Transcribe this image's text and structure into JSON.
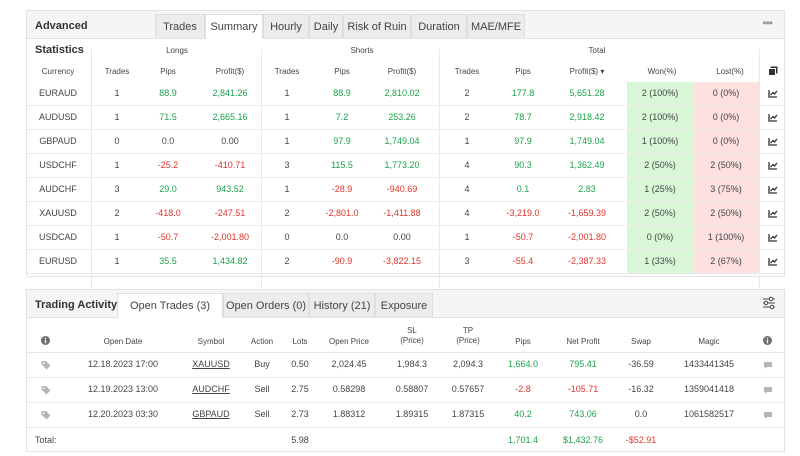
{
  "stats": {
    "title": "Advanced Statistics",
    "tabs": [
      "Trades",
      "Summary",
      "Hourly",
      "Daily",
      "Risk of Ruin",
      "Duration",
      "MAE/MFE"
    ],
    "active_tab": "Summary",
    "group_longs": "Longs",
    "group_shorts": "Shorts",
    "group_total": "Total",
    "columns": [
      "Currency",
      "Trades",
      "Pips",
      "Profit($)",
      "Trades",
      "Pips",
      "Profit($)",
      "Trades",
      "Pips",
      "Profit($)",
      "Won(%)",
      "Lost(%)"
    ],
    "rows": [
      {
        "currency": "EURAUD",
        "lt": "1",
        "lp": "88.9",
        "lpr": "2,841.26",
        "st": "1",
        "sp": "88.9",
        "spr": "2,810.02",
        "tt": "2",
        "tp": "177.8",
        "tpr": "5,651.28",
        "won": "2 (100%)",
        "lost": "0 (0%)"
      },
      {
        "currency": "AUDUSD",
        "lt": "1",
        "lp": "71.5",
        "lpr": "2,665.16",
        "st": "1",
        "sp": "7.2",
        "spr": "253.26",
        "tt": "2",
        "tp": "78.7",
        "tpr": "2,918.42",
        "won": "2 (100%)",
        "lost": "0 (0%)"
      },
      {
        "currency": "GBPAUD",
        "lt": "0",
        "lp": "0.0",
        "lpr": "0.00",
        "st": "1",
        "sp": "97.9",
        "spr": "1,749.04",
        "tt": "1",
        "tp": "97.9",
        "tpr": "1,749.04",
        "won": "1 (100%)",
        "lost": "0 (0%)"
      },
      {
        "currency": "USDCHF",
        "lt": "1",
        "lp": "-25.2",
        "lpr": "-410.71",
        "st": "3",
        "sp": "115.5",
        "spr": "1,773.20",
        "tt": "4",
        "tp": "90.3",
        "tpr": "1,362.49",
        "won": "2 (50%)",
        "lost": "2 (50%)"
      },
      {
        "currency": "AUDCHF",
        "lt": "3",
        "lp": "29.0",
        "lpr": "943.52",
        "st": "1",
        "sp": "-28.9",
        "spr": "-940.69",
        "tt": "4",
        "tp": "0.1",
        "tpr": "2.83",
        "won": "1 (25%)",
        "lost": "3 (75%)"
      },
      {
        "currency": "XAUUSD",
        "lt": "2",
        "lp": "-418.0",
        "lpr": "-247.51",
        "st": "2",
        "sp": "-2,801.0",
        "spr": "-1,411.88",
        "tt": "4",
        "tp": "-3,219.0",
        "tpr": "-1,659.39",
        "won": "2 (50%)",
        "lost": "2 (50%)"
      },
      {
        "currency": "USDCAD",
        "lt": "1",
        "lp": "-50.7",
        "lpr": "-2,001.80",
        "st": "0",
        "sp": "0.0",
        "spr": "0.00",
        "tt": "1",
        "tp": "-50.7",
        "tpr": "-2,001.80",
        "won": "0 (0%)",
        "lost": "1 (100%)"
      },
      {
        "currency": "EURUSD",
        "lt": "1",
        "lp": "35.5",
        "lpr": "1,434.82",
        "st": "2",
        "sp": "-90.9",
        "spr": "-3,822.15",
        "tt": "3",
        "tp": "-55.4",
        "tpr": "-2,387.33",
        "won": "1 (33%)",
        "lost": "2 (67%)"
      }
    ]
  },
  "activity": {
    "title": "Trading Activity",
    "tabs": [
      "Open Trades (3)",
      "Open Orders (0)",
      "History (21)",
      "Exposure"
    ],
    "active_tab": "Open Trades (3)",
    "columns": {
      "open_date": "Open Date",
      "symbol": "Symbol",
      "action": "Action",
      "lots": "Lots",
      "open_price": "Open Price",
      "sl_1": "SL",
      "sl_2": "(Price)",
      "tp_1": "TP",
      "tp_2": "(Price)",
      "pips": "Pips",
      "net_profit": "Net Profit",
      "swap": "Swap",
      "magic": "Magic"
    },
    "rows": [
      {
        "open_date": "12.18.2023 17:00",
        "symbol": "XAUUSD",
        "action": "Buy",
        "lots": "0.50",
        "open_price": "2,024.45",
        "sl": "1,984.3",
        "tp": "2,094.3",
        "pips": "1,664.0",
        "net_profit": "795.41",
        "swap": "-36.59",
        "magic": "1433441345"
      },
      {
        "open_date": "12.19.2023 13:00",
        "symbol": "AUDCHF",
        "action": "Sell",
        "lots": "2.75",
        "open_price": "0.58298",
        "sl": "0.58807",
        "tp": "0.57657",
        "pips": "-2.8",
        "net_profit": "-105.71",
        "swap": "-16.32",
        "magic": "1359041418"
      },
      {
        "open_date": "12.20.2023 03:30",
        "symbol": "GBPAUD",
        "action": "Sell",
        "lots": "2.73",
        "open_price": "1.88312",
        "sl": "1.89315",
        "tp": "1.87315",
        "pips": "40.2",
        "net_profit": "743.06",
        "swap": "0.0",
        "magic": "1061582517"
      }
    ],
    "total": {
      "label": "Total:",
      "lots": "5.98",
      "pips": "1,701.4",
      "net_profit": "$1,432.76",
      "swap": "-$52.91"
    }
  },
  "colors": {
    "positive": "#1aa34a",
    "negative": "#e2342c",
    "won_bg": "#d9f7d6",
    "lost_bg": "#fde0e0"
  }
}
